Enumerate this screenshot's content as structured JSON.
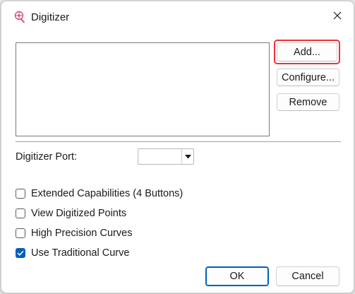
{
  "window": {
    "title": "Digitizer",
    "icon": "digitizer-app-icon",
    "close_icon": "close-icon"
  },
  "side_buttons": {
    "add_label": "Add...",
    "configure_label": "Configure...",
    "remove_label": "Remove"
  },
  "port": {
    "label": "Digitizer Port:",
    "selected_value": ""
  },
  "options": [
    {
      "label": "Extended Capabilities (4 Buttons)",
      "checked": false
    },
    {
      "label": "View Digitized Points",
      "checked": false
    },
    {
      "label": "High Precision Curves",
      "checked": false
    },
    {
      "label": "Use Traditional Curve",
      "checked": true
    }
  ],
  "footer": {
    "ok_label": "OK",
    "cancel_label": "Cancel"
  },
  "colors": {
    "accent": "#005fb8",
    "highlight": "#e8323c",
    "icon_pink": "#e0457b"
  }
}
